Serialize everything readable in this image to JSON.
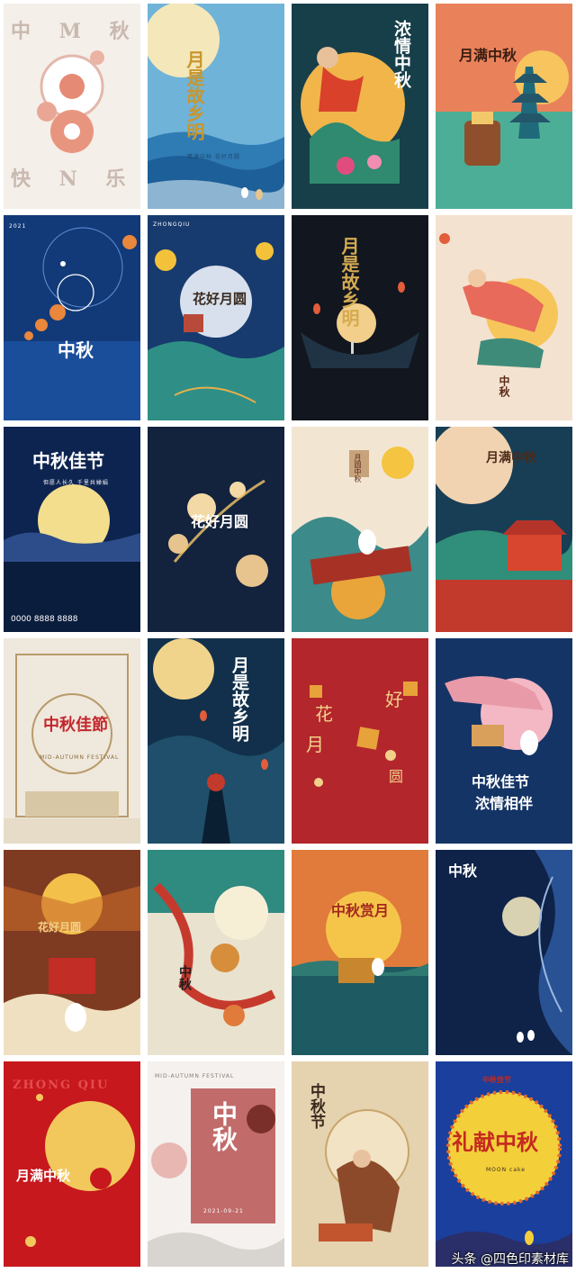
{
  "watermark": "头条 @四色印素材库",
  "colors": {
    "page_bg": "#ffffff",
    "tile_1_1_bg": "#f4efe9",
    "tile_1_2_bg": "#6fb3d8",
    "tile_1_3_bg": "#173f4a",
    "tile_1_4_bg": "#e9825b",
    "tile_2_1_bg": "#123a78",
    "tile_2_2_bg": "#173b6e",
    "tile_2_3_bg": "#12161f",
    "tile_2_4_bg": "#f3e2cf",
    "tile_3_1_bg": "#0e2450",
    "tile_3_2_bg": "#13223d",
    "tile_3_3_bg": "#f2e6d3",
    "tile_3_4_bg": "#183e55",
    "tile_4_1_bg": "#efe8dc",
    "tile_4_2_bg": "#12304b",
    "tile_4_3_bg": "#b3262c",
    "tile_4_4_bg": "#143466",
    "tile_5_1_bg": "#7e3b22",
    "tile_5_2_bg": "#e9e2cf",
    "tile_5_3_bg": "#e07b3b",
    "tile_5_4_bg": "#0f2248",
    "tile_6_1_bg": "#c7181e",
    "tile_6_2_bg": "#f4f1ee",
    "tile_6_3_bg": "#e5d2ae",
    "tile_6_4_bg": "#1a3f9c"
  },
  "posters": {
    "p1": {
      "top": "中 M 秋",
      "bottom": "快 N 乐"
    },
    "p2": {
      "title": "月是故乡明",
      "caption": "情满中秋 花好月圆"
    },
    "p3": {
      "title": "浓情中秋"
    },
    "p4": {
      "title": "月满中秋"
    },
    "p5": {
      "year": "2021",
      "title": "中秋"
    },
    "p6": {
      "label": "ZHONGQIU",
      "title": "花好月圆"
    },
    "p7": {
      "title": "月是故乡明"
    },
    "p8": {
      "title": "中秋"
    },
    "p9": {
      "title": "中秋佳节",
      "caption": "但愿人长久 千里共婵娟",
      "phone": "0000 8888 8888"
    },
    "p10": {
      "title": "花好月圆"
    },
    "p11": {
      "title": "月圆中秋"
    },
    "p12": {
      "title": "月满中秋"
    },
    "p13": {
      "title": "中秋佳節",
      "sub": "MID-AUTUMN FESTIVAL"
    },
    "p14": {
      "title": "月是故乡明"
    },
    "p15": {
      "a": "花",
      "b": "好",
      "c": "月",
      "d": "圆"
    },
    "p16": {
      "line1": "中秋佳节",
      "line2": "浓情相伴"
    },
    "p17": {
      "title": "花好月圆"
    },
    "p18": {
      "title": "中秋"
    },
    "p19": {
      "title": "中秋赏月"
    },
    "p20": {
      "title": "中秋"
    },
    "p21": {
      "title": "月满中秋",
      "latin": "ZHONG QIU"
    },
    "p22": {
      "title": "中秋",
      "sub": "MID-AUTUMN FESTIVAL",
      "date": "2021-09-21"
    },
    "p23": {
      "title": "中秋节"
    },
    "p24": {
      "title": "礼献中秋",
      "top": "中秋佳节",
      "sub": "MOON cake"
    }
  }
}
